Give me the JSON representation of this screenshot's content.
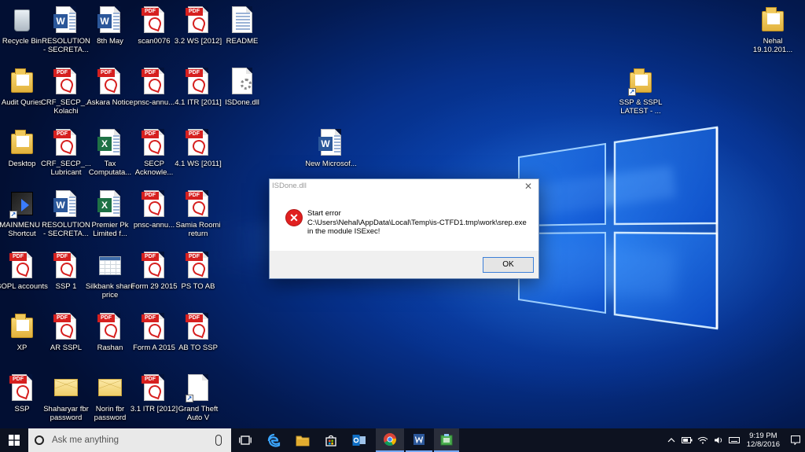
{
  "desktop": {
    "icons": [
      {
        "label": "Recycle Bin",
        "kind": "recycle"
      },
      {
        "label": "RESOLUTION - SECRETA...",
        "kind": "word"
      },
      {
        "label": "8th May",
        "kind": "word"
      },
      {
        "label": "scan0076",
        "kind": "pdf"
      },
      {
        "label": "3.2 WS [2012]",
        "kind": "pdf"
      },
      {
        "label": "README",
        "kind": "text"
      },
      {
        "label": "Audit Quries",
        "kind": "folder"
      },
      {
        "label": "CRF_SECP_... Kolachi",
        "kind": "pdf"
      },
      {
        "label": "Askara Notice",
        "kind": "pdf"
      },
      {
        "label": "pnsc-annu...",
        "kind": "pdf"
      },
      {
        "label": "4.1 ITR [2011]",
        "kind": "pdf"
      },
      {
        "label": "ISDone.dll",
        "kind": "dll"
      },
      {
        "label": "Desktop",
        "kind": "folder"
      },
      {
        "label": "CRF_SECP_... Lubricant",
        "kind": "pdf"
      },
      {
        "label": "Tax Computata...",
        "kind": "excel"
      },
      {
        "label": "SECP Acknowle...",
        "kind": "pdf"
      },
      {
        "label": "4.1 WS [2011]",
        "kind": "pdf"
      },
      {
        "label": "New Microsof...",
        "kind": "word"
      },
      {
        "label": "MAINMENU - Shortcut",
        "kind": "shortcut"
      },
      {
        "label": "RESOLUTION - SECRETA...",
        "kind": "word"
      },
      {
        "label": "Premier Pk Limited f...",
        "kind": "excel"
      },
      {
        "label": "pnsc-annu...",
        "kind": "pdf"
      },
      {
        "label": "Samia Roomi return",
        "kind": "pdf"
      },
      {
        "label": "BOPL accounts",
        "kind": "pdf"
      },
      {
        "label": "SSP 1",
        "kind": "pdf"
      },
      {
        "label": "Silkbank share price",
        "kind": "spreadsheet"
      },
      {
        "label": "Form 29 2015",
        "kind": "pdf"
      },
      {
        "label": "PS TO AB",
        "kind": "pdf"
      },
      {
        "label": "XP",
        "kind": "folder"
      },
      {
        "label": "AR SSPL",
        "kind": "pdf"
      },
      {
        "label": "Rashan",
        "kind": "pdf"
      },
      {
        "label": "Form A 2015",
        "kind": "pdf"
      },
      {
        "label": "AB TO SSP",
        "kind": "pdf"
      },
      {
        "label": "SSP",
        "kind": "pdf"
      },
      {
        "label": "Shaharyar fbr password",
        "kind": "envelope"
      },
      {
        "label": "Norin fbr password",
        "kind": "envelope"
      },
      {
        "label": "3.1 ITR [2012]",
        "kind": "pdf"
      },
      {
        "label": "Grand Theft Auto V",
        "kind": "text"
      },
      {
        "label": "SSP & SSPL LATEST - ...",
        "kind": "folder"
      },
      {
        "label": "Nehal 19.10.201...",
        "kind": "folder"
      }
    ]
  },
  "dialog": {
    "title": "ISDone.dll",
    "message_line1": "Start error",
    "message_line2": "C:\\Users\\Nehal\\AppData\\Local\\Temp\\is-CTFD1.tmp\\work\\srep.exe",
    "message_line3": "in the module ISExec!",
    "ok_label": "OK",
    "close_glyph": "✕",
    "error_glyph": "✕"
  },
  "taskbar": {
    "search_placeholder": "Ask me anything",
    "clock_time": "9:19 PM",
    "clock_date": "12/8/2016"
  },
  "colors": {
    "accent": "#3c7fd8",
    "error": "#e02020",
    "taskbar": "#0d1220"
  }
}
